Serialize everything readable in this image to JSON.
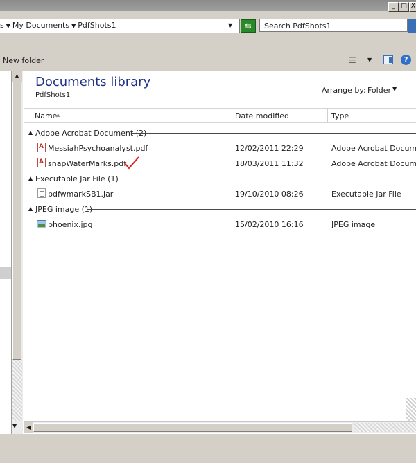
{
  "window": {
    "minimize": "_",
    "maximize": "□",
    "close": "X"
  },
  "address": {
    "crumbs": [
      "s",
      "My Documents",
      "PdfShots1"
    ],
    "search_placeholder": "Search PdfShots1"
  },
  "toolbar": {
    "new_folder_label": "New folder"
  },
  "library": {
    "title": "Documents library",
    "subtitle": "PdfShots1",
    "arrange_by_label": "Arrange by:",
    "arrange_by_value": "Folder"
  },
  "columns": {
    "name": "Name",
    "date_modified": "Date modified",
    "type": "Type"
  },
  "groups": [
    {
      "label": "Adobe Acrobat Document (2)",
      "files": [
        {
          "name": "MessiahPsychoanalyst.pdf",
          "date": "12/02/2011 22:29",
          "type": "Adobe Acrobat Document",
          "icon": "pdf-icon"
        },
        {
          "name": "snapWaterMarks.pdf",
          "date": "18/03/2011 11:32",
          "type": "Adobe Acrobat Document",
          "icon": "pdf-icon"
        }
      ]
    },
    {
      "label": "Executable Jar File (1)",
      "files": [
        {
          "name": "pdfwmarkSB1.jar",
          "date": "19/10/2010 08:26",
          "type": "Executable Jar File",
          "icon": "jar-icon"
        }
      ]
    },
    {
      "label": "JPEG image (1)",
      "files": [
        {
          "name": "phoenix.jpg",
          "date": "15/02/2010 16:16",
          "type": "JPEG image",
          "icon": "jpg-icon"
        }
      ]
    }
  ],
  "colors": {
    "chrome": "#d4d0c8",
    "library_title": "#1e3287",
    "checkmark": "#e0201a"
  }
}
